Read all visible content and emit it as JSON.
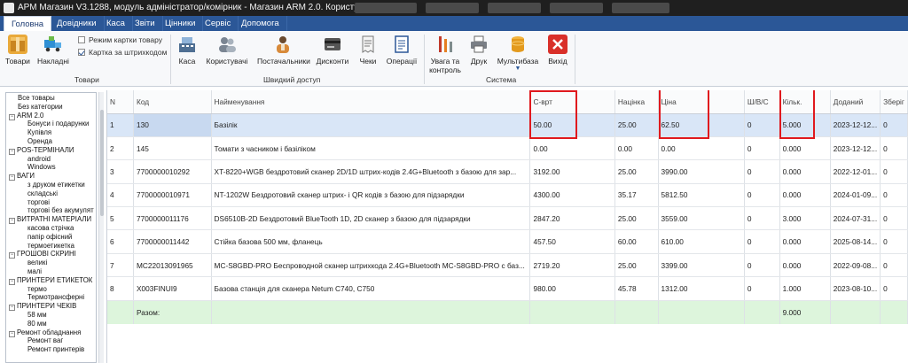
{
  "window": {
    "title": "АРМ Магазин V3.1288, модуль адміністратор/комірник - Магазин ARM 2.0. Користувач: Admin"
  },
  "menu": {
    "tabs": [
      "Головна",
      "Довідники",
      "Каса",
      "Звіти",
      "Цінники",
      "Сервіс",
      "Допомога"
    ],
    "active": "Головна"
  },
  "ribbon": {
    "goods_group": {
      "label": "Товари",
      "buttons": [
        "Товари",
        "Накладні"
      ],
      "check_card_mode": "Режим картки товару",
      "check_barcode_card": "Картка за штрихкодом"
    },
    "quick_group": {
      "label": "Швидкий доступ",
      "buttons": [
        "Каса",
        "Користувачі",
        "Постачальники",
        "Дисконти",
        "Чеки",
        "Операції"
      ]
    },
    "system_group": {
      "label": "Система",
      "attention_line1": "Увага та",
      "attention_line2": "контроль",
      "print": "Друк",
      "multibase": "Мультибаза",
      "exit": "Вихід"
    }
  },
  "tree": [
    {
      "label": "Все товары",
      "level": 0
    },
    {
      "label": "Без категории",
      "level": 0
    },
    {
      "label": "ARM 2.0",
      "level": 0,
      "expanded": true
    },
    {
      "label": "Бонуси і подарунки",
      "level": 1
    },
    {
      "label": "Купівля",
      "level": 1
    },
    {
      "label": "Оренда",
      "level": 1
    },
    {
      "label": "POS-ТЕРМІНАЛИ",
      "level": 0,
      "expanded": true
    },
    {
      "label": "android",
      "level": 1
    },
    {
      "label": "Windows",
      "level": 1
    },
    {
      "label": "ВАГИ",
      "level": 0,
      "expanded": true
    },
    {
      "label": "з друком етикетки",
      "level": 1
    },
    {
      "label": "складські",
      "level": 1
    },
    {
      "label": "торгові",
      "level": 1
    },
    {
      "label": "торгові без акумулят",
      "level": 1
    },
    {
      "label": "ВИТРАТНІ МАТЕРІАЛИ",
      "level": 0,
      "expanded": true
    },
    {
      "label": "касова стрічка",
      "level": 1
    },
    {
      "label": "папір офісний",
      "level": 1
    },
    {
      "label": "термоетикетка",
      "level": 1
    },
    {
      "label": "ГРОШОВІ СКРИНІ",
      "level": 0,
      "expanded": true
    },
    {
      "label": "великі",
      "level": 1
    },
    {
      "label": "малі",
      "level": 1
    },
    {
      "label": "ПРИНТЕРИ ЕТИКЕТОК",
      "level": 0,
      "expanded": true
    },
    {
      "label": "термо",
      "level": 1
    },
    {
      "label": "Термотрансферні",
      "level": 1
    },
    {
      "label": "ПРИНТЕРИ ЧЕКІВ",
      "level": 0,
      "expanded": true
    },
    {
      "label": "58 мм",
      "level": 1
    },
    {
      "label": "80 мм",
      "level": 1
    },
    {
      "label": "Ремонт обладнання",
      "level": 0,
      "expanded": true
    },
    {
      "label": "Ремонт ваг",
      "level": 1
    },
    {
      "label": "Ремонт принтерів",
      "level": 1
    }
  ],
  "table": {
    "columns": [
      "N",
      "Код",
      "Найменування",
      "С-врт",
      "Націнка",
      "Ціна",
      "Ш/В/С",
      "Кільк.",
      "Доданий",
      "Зберіг"
    ],
    "rows": [
      [
        "1",
        "130",
        "Базілік",
        "50.00",
        "25.00",
        "62.50",
        "0",
        "5.000",
        "2023-12-12...",
        "0"
      ],
      [
        "2",
        "145",
        "Томати з часником і базіліком",
        "0.00",
        "0.00",
        "0.00",
        "0",
        "0.000",
        "2023-12-12...",
        "0"
      ],
      [
        "3",
        "7700000010292",
        "XT-8220+WGB бездротовий сканер 2D/1D штрих-кодів 2.4G+Bluetooth з базою для зар...",
        "3192.00",
        "25.00",
        "3990.00",
        "0",
        "0.000",
        "2022-12-01...",
        "0"
      ],
      [
        "4",
        "7700000010971",
        "NT-1202W Бездротовий сканер штрих- і QR кодів з базою для підзарядки",
        "4300.00",
        "35.17",
        "5812.50",
        "0",
        "0.000",
        "2024-01-09...",
        "0"
      ],
      [
        "5",
        "7700000011176",
        "DS6510B-2D Бездротовий BlueTooth 1D, 2D сканер з базою для підзарядки",
        "2847.20",
        "25.00",
        "3559.00",
        "0",
        "3.000",
        "2024-07-31...",
        "0"
      ],
      [
        "6",
        "7700000011442",
        "Стійка базова 500 мм, фланець",
        "457.50",
        "60.00",
        "610.00",
        "0",
        "0.000",
        "2025-08-14...",
        "0"
      ],
      [
        "7",
        "MC22013091965",
        "MC-S8GBD-PRO Беспроводной сканер штрихкода 2.4G+Bluetooth MC-S8GBD-PRO с баз...",
        "2719.20",
        "25.00",
        "3399.00",
        "0",
        "0.000",
        "2022-09-08...",
        "0"
      ],
      [
        "8",
        "X003FINUI9",
        "Базова станція для сканера Netum C740, C750",
        "980.00",
        "45.78",
        "1312.00",
        "0",
        "1.000",
        "2023-08-10...",
        "0"
      ]
    ],
    "total": {
      "label": "Разом:",
      "qty": "9.000"
    }
  },
  "colors": {
    "accent": "#2b5797",
    "selected_row": "#d9e6f7",
    "total_row": "#ddf5dc",
    "highlight": "#e0191e"
  }
}
